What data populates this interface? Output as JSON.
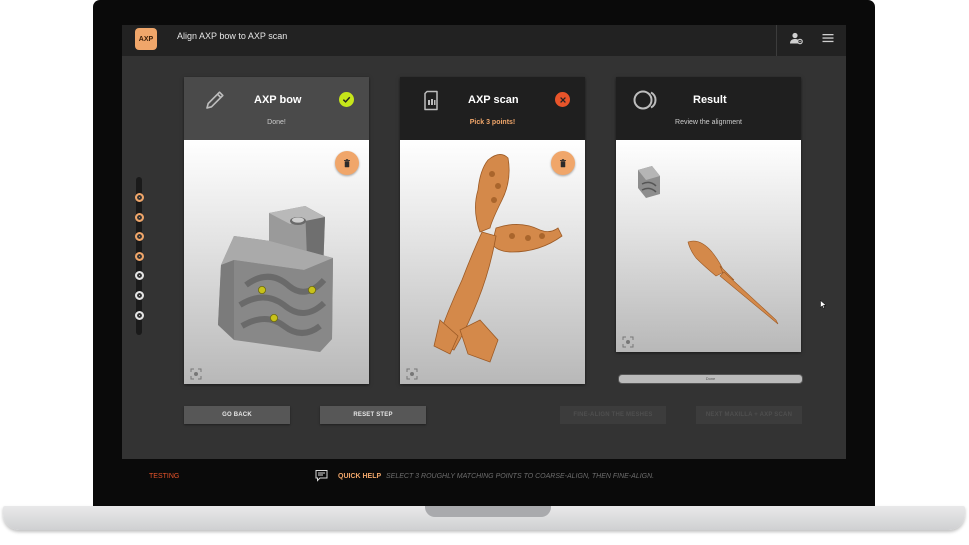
{
  "app": {
    "logo_text": "AXP",
    "title": "Align AXP bow to AXP scan",
    "accent_color": "#f0a66a"
  },
  "topbar": {
    "icons": [
      "user-settings-icon",
      "hamburger-menu-icon"
    ]
  },
  "steps": [
    {
      "state": "done"
    },
    {
      "state": "done"
    },
    {
      "state": "done"
    },
    {
      "state": "done"
    },
    {
      "state": "todo"
    },
    {
      "state": "todo"
    },
    {
      "state": "todo"
    }
  ],
  "cards": [
    {
      "title": "AXP bow",
      "subtitle": "Done!",
      "icon": "pencil-icon",
      "status_icon": "check-icon",
      "status_color": "#c6e61a",
      "header_color": "#4a4a4a"
    },
    {
      "title": "AXP scan",
      "subtitle": "Pick 3 points!",
      "icon": "sd-card-icon",
      "status_icon": "close-icon",
      "status_color": "#e8542a",
      "header_color": "#1f1f1f"
    },
    {
      "title": "Result",
      "subtitle": "Review the alignment",
      "icon": "overlap-circles-icon",
      "header_color": "#1f1f1f"
    }
  ],
  "result_bar_text": "Done",
  "buttons": {
    "go_back": "GO BACK",
    "reset_step": "RESET STEP",
    "fine_align": "FINE-ALIGN THE MESHES",
    "next": "NEXT MAXILLA + AXP SCAN"
  },
  "footer": {
    "testing_label": "TESTING",
    "help_label": "QUICK HELP",
    "help_text": "SELECT 3 ROUGHLY MATCHING POINTS TO COARSE-ALIGN, THEN FINE-ALIGN."
  }
}
